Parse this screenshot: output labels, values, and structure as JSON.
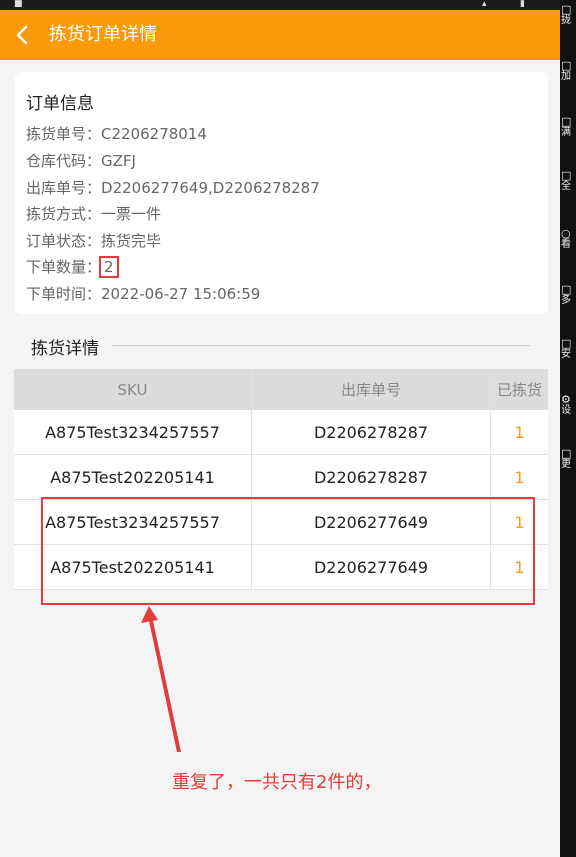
{
  "app_bar": {
    "title": "拣货订单详情"
  },
  "order_info": {
    "title": "订单信息",
    "rows": [
      {
        "label": "拣货单号：",
        "value": "C2206278014"
      },
      {
        "label": "仓库代码：",
        "value": "GZFJ"
      },
      {
        "label": "出库单号：",
        "value": "D2206277649,D2206278287"
      },
      {
        "label": "拣货方式：",
        "value": "一票一件"
      },
      {
        "label": "订单状态：",
        "value": "拣货完毕"
      },
      {
        "label": "下单数量：",
        "value": "2"
      },
      {
        "label": "下单时间：",
        "value": "2022-06-27 15:06:59"
      }
    ]
  },
  "detail": {
    "title": "拣货详情",
    "columns": [
      "SKU",
      "出库单号",
      "已拣货"
    ],
    "rows": [
      {
        "sku": "A875Test3234257557",
        "order": "D2206278287",
        "picked": "1"
      },
      {
        "sku": "A875Test202205141",
        "order": "D2206278287",
        "picked": "1"
      },
      {
        "sku": "A875Test3234257557",
        "order": "D2206277649",
        "picked": "1"
      },
      {
        "sku": "A875Test202205141",
        "order": "D2206277649",
        "picked": "1"
      }
    ]
  },
  "annotation": {
    "text": "重复了，一共只有2件的，",
    "color": "#e23b3b"
  },
  "side_panel": [
    {
      "glyph": "□",
      "label": "拢"
    },
    {
      "glyph": "□",
      "label": "加"
    },
    {
      "glyph": "□",
      "label": "满"
    },
    {
      "glyph": "□",
      "label": "全"
    },
    {
      "glyph": "○",
      "label": "看"
    },
    {
      "glyph": "□",
      "label": "多"
    },
    {
      "glyph": "□",
      "label": "安"
    },
    {
      "glyph": "⚙",
      "label": "设"
    },
    {
      "glyph": "□",
      "label": "更"
    }
  ],
  "colors": {
    "accent": "#fa9a0a",
    "picked": "#f29b11",
    "annotation": "#e23b3b"
  }
}
